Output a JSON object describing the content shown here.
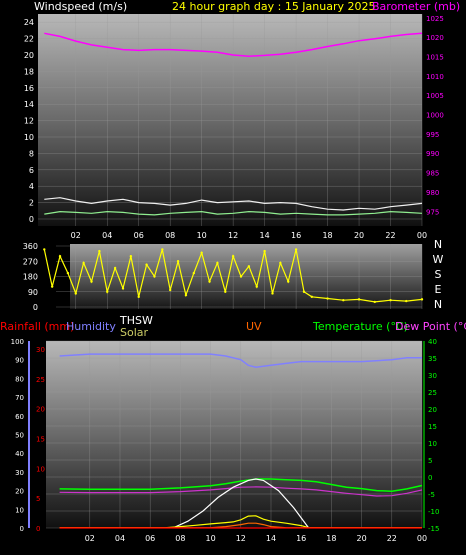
{
  "header": {
    "wind_title": "Windspeed (m/s)",
    "graph_title": "24 hour graph day : 15 January 2025",
    "baro_title": "Barometer (mb)"
  },
  "colors": {
    "wind_gust": "#f0f0f0",
    "wind_avg": "#90ee90",
    "barometer": "#ff00ff",
    "direction": "#ffff00",
    "humidity": "#8080ff",
    "temperature": "#00ff00",
    "dew_point": "#cc33cc",
    "rain": "#ff0000",
    "solar": "#ffff00",
    "uv": "#ff6600",
    "thsw": "#ffffff"
  },
  "chart_data": [
    {
      "type": "line",
      "name": "wind-and-barometer",
      "ylabel": "Windspeed (m/s)",
      "ylabel_right": "Barometer (mb)",
      "yticks": [
        0,
        2,
        4,
        6,
        8,
        10,
        12,
        14,
        16,
        18,
        20,
        22,
        24
      ],
      "yticks_right": [
        975,
        980,
        985,
        990,
        995,
        1000,
        1005,
        1010,
        1015,
        1020,
        1025
      ],
      "xticks": [
        "02",
        "04",
        "06",
        "08",
        "10",
        "12",
        "14",
        "16",
        "18",
        "20",
        "22",
        "00"
      ],
      "ylim": [
        0,
        25
      ],
      "ylim_right": [
        973,
        1026
      ],
      "series": [
        {
          "key": "barometer",
          "axis": "right",
          "x": [
            0,
            1,
            2,
            3,
            4,
            5,
            6,
            7,
            8,
            9,
            10,
            11,
            12,
            13,
            14,
            15,
            16,
            17,
            18,
            19,
            20,
            21,
            22,
            23,
            24
          ],
          "y": [
            1021,
            1020.2,
            1019,
            1018,
            1017.4,
            1016.8,
            1016.6,
            1016.8,
            1016.8,
            1016.6,
            1016.4,
            1016.1,
            1015.4,
            1015.1,
            1015.3,
            1015.6,
            1016.1,
            1016.8,
            1017.6,
            1018.3,
            1019.1,
            1019.6,
            1020.2,
            1020.7,
            1021
          ]
        },
        {
          "key": "wind_gust",
          "axis": "left",
          "x": [
            0,
            1,
            2,
            3,
            4,
            5,
            6,
            7,
            8,
            9,
            10,
            11,
            12,
            13,
            14,
            15,
            16,
            17,
            18,
            19,
            20,
            21,
            22,
            23,
            24
          ],
          "y": [
            2.4,
            2.6,
            2.2,
            1.9,
            2.2,
            2.4,
            2.0,
            1.9,
            1.7,
            1.9,
            2.3,
            2.0,
            2.1,
            2.2,
            1.9,
            2.0,
            1.9,
            1.5,
            1.2,
            1.1,
            1.3,
            1.2,
            1.5,
            1.7,
            1.9
          ]
        },
        {
          "key": "wind_avg",
          "axis": "left",
          "x": [
            0,
            1,
            2,
            3,
            4,
            5,
            6,
            7,
            8,
            9,
            10,
            11,
            12,
            13,
            14,
            15,
            16,
            17,
            18,
            19,
            20,
            21,
            22,
            23,
            24
          ],
          "y": [
            0.6,
            0.9,
            0.8,
            0.7,
            0.9,
            0.8,
            0.6,
            0.5,
            0.7,
            0.8,
            0.9,
            0.6,
            0.7,
            0.9,
            0.8,
            0.6,
            0.7,
            0.6,
            0.5,
            0.5,
            0.6,
            0.7,
            0.9,
            0.8,
            0.7
          ]
        }
      ]
    },
    {
      "type": "scatter",
      "name": "wind-direction",
      "yticks": [
        0,
        90,
        180,
        270,
        360
      ],
      "compass": [
        "N",
        "W",
        "S",
        "E",
        "N"
      ],
      "ylim": [
        0,
        360
      ],
      "xticks": [
        "02",
        "04",
        "06",
        "08",
        "10",
        "12",
        "14",
        "16",
        "18",
        "20",
        "22",
        "00"
      ],
      "series": [
        {
          "key": "direction",
          "x": [
            0,
            0.5,
            1,
            1.5,
            2,
            2.5,
            3,
            3.5,
            4,
            4.5,
            5,
            5.5,
            6,
            6.5,
            7,
            7.5,
            8,
            8.5,
            9,
            9.5,
            10,
            10.5,
            11,
            11.5,
            12,
            12.5,
            13,
            13.5,
            14,
            14.5,
            15,
            15.5,
            16,
            16.5,
            17,
            18,
            19,
            20,
            21,
            22,
            23,
            24
          ],
          "y": [
            340,
            120,
            300,
            200,
            80,
            260,
            150,
            330,
            90,
            230,
            110,
            300,
            60,
            250,
            180,
            340,
            100,
            270,
            70,
            200,
            320,
            150,
            260,
            90,
            300,
            180,
            240,
            120,
            330,
            80,
            260,
            150,
            340,
            90,
            60,
            50,
            40,
            45,
            30,
            40,
            35,
            45
          ]
        }
      ]
    },
    {
      "type": "line",
      "name": "temperature-humidity-rain-solar",
      "ylabel_left_rain": "Rainfall (mm)",
      "ylabel_left_humidity": "Humidity",
      "ylabel_mid_thsw": "THSW",
      "ylabel_mid_solar": "Solar",
      "ylabel_mid_uv": "UV",
      "ylabel_right_temp": "Temperature (°C)",
      "ylabel_right_dew": "Dew Point (°C)",
      "yticks_humidity": [
        0,
        10,
        20,
        30,
        40,
        50,
        60,
        70,
        80,
        90,
        100
      ],
      "yticks_rain": [
        0,
        5,
        10,
        15,
        20,
        25,
        30
      ],
      "yticks_temp": [
        -15,
        -10,
        -5,
        0,
        5,
        10,
        15,
        20,
        25,
        30,
        35,
        40
      ],
      "xticks": [
        "02",
        "04",
        "06",
        "08",
        "10",
        "12",
        "14",
        "16",
        "18",
        "20",
        "22",
        "00"
      ],
      "ylim_humidity": [
        0,
        100
      ],
      "ylim_temp": [
        -15,
        40
      ],
      "series": [
        {
          "key": "humidity",
          "axis": "humidity",
          "x": [
            0,
            2,
            4,
            6,
            8,
            10,
            11,
            12,
            12.5,
            13,
            14,
            15,
            16,
            17,
            18,
            20,
            22,
            23,
            24
          ],
          "y": [
            92,
            93,
            93,
            93,
            93,
            93,
            92,
            90,
            87,
            86,
            87,
            88,
            89,
            89,
            89,
            89,
            90,
            91,
            91
          ]
        },
        {
          "key": "temperature",
          "axis": "temp",
          "x": [
            0,
            2,
            4,
            6,
            8,
            10,
            11,
            12,
            13,
            14,
            15,
            16,
            17,
            18,
            19,
            20,
            21,
            22,
            23,
            24
          ],
          "y": [
            -3.5,
            -3.6,
            -3.6,
            -3.6,
            -3.2,
            -2.6,
            -2.0,
            -1.2,
            -0.6,
            -0.6,
            -0.8,
            -1.0,
            -1.4,
            -2.2,
            -3.0,
            -3.4,
            -4.0,
            -4.2,
            -3.5,
            -2.5
          ]
        },
        {
          "key": "dew_point",
          "axis": "temp",
          "x": [
            0,
            2,
            4,
            6,
            8,
            10,
            11,
            12,
            13,
            14,
            15,
            16,
            17,
            18,
            19,
            20,
            21,
            22,
            23,
            24
          ],
          "y": [
            -4.5,
            -4.6,
            -4.6,
            -4.6,
            -4.3,
            -3.8,
            -3.4,
            -3.0,
            -2.9,
            -3.0,
            -3.3,
            -3.5,
            -3.8,
            -4.3,
            -4.8,
            -5.2,
            -5.6,
            -5.5,
            -4.8,
            -3.8
          ]
        },
        {
          "key": "thsw",
          "axis": "temp",
          "x": [
            7.5,
            8.5,
            9.5,
            10.5,
            11.5,
            12.5,
            13,
            13.5,
            14.5,
            15.5,
            16.5
          ],
          "y": [
            -15,
            -13,
            -10,
            -6,
            -3,
            -1,
            -0.6,
            -1,
            -4,
            -9,
            -15
          ]
        },
        {
          "key": "solar",
          "axis": "temp",
          "x": [
            0,
            7,
            8,
            9,
            10,
            11,
            11.5,
            12,
            12.5,
            13,
            13.5,
            14,
            15,
            16,
            16.5,
            17,
            24
          ],
          "y": [
            -14.9,
            -14.9,
            -14.6,
            -14.2,
            -13.8,
            -13.4,
            -13.2,
            -12.6,
            -11.5,
            -11.4,
            -12.4,
            -13.0,
            -13.6,
            -14.3,
            -14.9,
            -14.9,
            -14.9
          ]
        },
        {
          "key": "uv",
          "axis": "temp",
          "x": [
            0,
            10,
            11,
            12,
            12.5,
            13,
            13.5,
            14,
            15,
            24
          ],
          "y": [
            -14.9,
            -14.9,
            -14.6,
            -14.0,
            -13.6,
            -13.6,
            -14.0,
            -14.6,
            -14.9,
            -14.9
          ]
        },
        {
          "key": "rain",
          "axis": "rain",
          "x": [
            0,
            24
          ],
          "y": [
            0,
            0
          ]
        }
      ]
    }
  ]
}
